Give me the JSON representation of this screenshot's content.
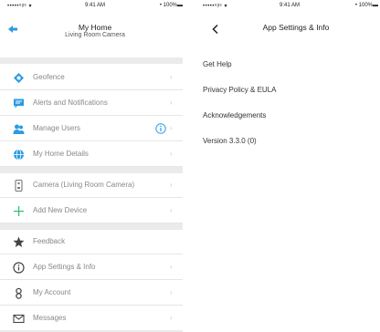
{
  "left": {
    "status": {
      "carrier": "•••••ᵘᵍᵉ ▾",
      "time": "9:41 AM",
      "battery": "• 100%▬"
    },
    "header": {
      "title": "My Home",
      "subtitle": "Living Room Camera"
    },
    "menu": [
      {
        "label": "Geofence"
      },
      {
        "label": "Alerts and Notifications"
      },
      {
        "label": "Manage Users"
      },
      {
        "label": "My Home Details"
      },
      {
        "label": "Camera (Living Room Camera)"
      },
      {
        "label": "Add New Device"
      },
      {
        "label": "Feedback"
      },
      {
        "label": "App Settings & Info"
      },
      {
        "label": "My Account"
      },
      {
        "label": "Messages"
      }
    ]
  },
  "right": {
    "status": {
      "carrier": "•••••ᵘᵍᵉ ▾",
      "time": "9:41 AM",
      "battery": "• 100%▬"
    },
    "header": {
      "title": "App Settings & Info"
    },
    "items": [
      {
        "label": "Get Help"
      },
      {
        "label": "Privacy Policy & EULA"
      },
      {
        "label": "Acknowledgements"
      },
      {
        "label": "Version 3.3.0 (0)"
      }
    ]
  },
  "colors": {
    "accent": "#2b9be3",
    "badge": "#2b9be3",
    "divider": "#ebebeb",
    "chevron": "#c8c8c8"
  }
}
